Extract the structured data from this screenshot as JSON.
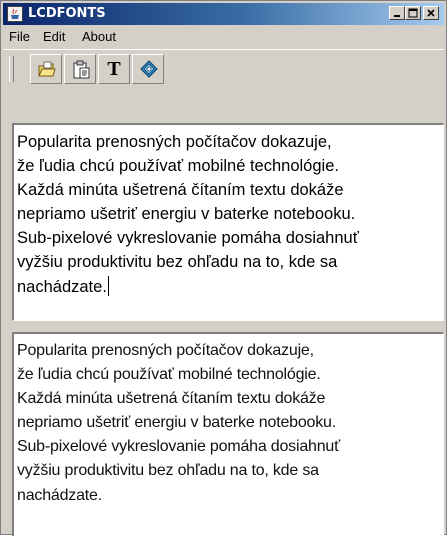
{
  "window": {
    "title": "LCDFONTS",
    "controls": {
      "minimize": "_",
      "maximize": "□",
      "close": "×"
    }
  },
  "menubar": {
    "items": [
      {
        "label": "File"
      },
      {
        "label": "Edit"
      },
      {
        "label": "About"
      }
    ]
  },
  "toolbar": {
    "buttons": [
      {
        "icon": "open-folder-icon"
      },
      {
        "icon": "paste-document-icon"
      },
      {
        "icon": "font-icon",
        "glyph": "T"
      },
      {
        "icon": "settings-icon"
      }
    ]
  },
  "editor_top": {
    "lines": [
      "Popularita prenosných počítačov dokazuje,",
      "že ľudia chcú používať mobilné technológie.",
      "Každá minúta ušetrená čítaním textu dokáže",
      "nepriamo ušetriť energiu v baterke notebooku.",
      "Sub-pixelové vykreslovanie pomáha dosiahnuť",
      "vyžšiu produktivitu bez ohľadu na to, kde sa",
      "nachádzate."
    ]
  },
  "preview_bottom": {
    "lines": [
      "Popularita prenosných počítačov dokazuje,",
      "že ľudia chcú používať mobilné technológie.",
      "Každá minúta ušetrená čítaním textu dokáže",
      "nepriamo ušetriť energiu v baterke notebooku.",
      "Sub-pixelové vykreslovanie pomáha dosiahnuť",
      "vyžšiu produktivitu bez ohľadu na to, kde sa",
      "nachádzate."
    ]
  },
  "colors": {
    "titlebar_start": "#0a246a",
    "titlebar_end": "#a6caf0",
    "chrome": "#d4d0c8"
  }
}
